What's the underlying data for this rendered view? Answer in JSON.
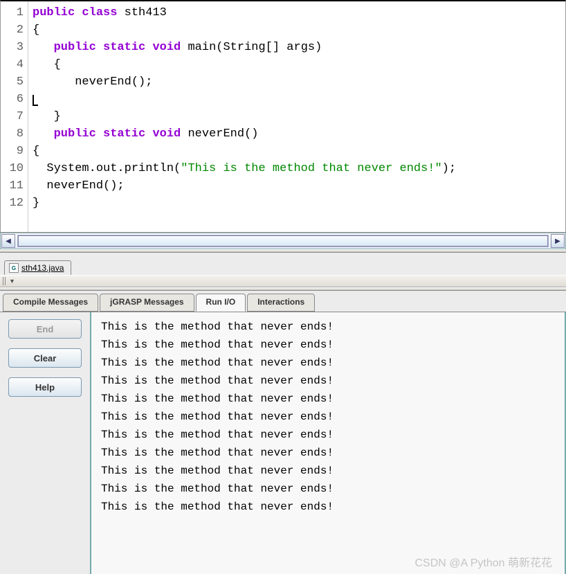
{
  "code": {
    "lines": [
      {
        "num": "1",
        "segments": [
          {
            "t": "public",
            "c": "kw-public"
          },
          {
            "t": " "
          },
          {
            "t": "class",
            "c": "kw-class"
          },
          {
            "t": " sth413"
          }
        ]
      },
      {
        "num": "2",
        "segments": [
          {
            "t": "{"
          }
        ]
      },
      {
        "num": "3",
        "segments": [
          {
            "t": "   "
          },
          {
            "t": "public",
            "c": "kw-public"
          },
          {
            "t": " "
          },
          {
            "t": "static",
            "c": "kw-static"
          },
          {
            "t": " "
          },
          {
            "t": "void",
            "c": "kw-void"
          },
          {
            "t": " main(String[] args)"
          }
        ]
      },
      {
        "num": "4",
        "segments": [
          {
            "t": "   {"
          }
        ]
      },
      {
        "num": "5",
        "segments": [
          {
            "t": "      neverEnd();"
          }
        ]
      },
      {
        "num": "6",
        "segments": [
          {
            "t": "",
            "cursor": true
          }
        ]
      },
      {
        "num": "7",
        "segments": [
          {
            "t": "   }"
          }
        ]
      },
      {
        "num": "8",
        "segments": [
          {
            "t": "   "
          },
          {
            "t": "public",
            "c": "kw-public"
          },
          {
            "t": " "
          },
          {
            "t": "static",
            "c": "kw-static"
          },
          {
            "t": " "
          },
          {
            "t": "void",
            "c": "kw-void"
          },
          {
            "t": " neverEnd()"
          }
        ]
      },
      {
        "num": "9",
        "segments": [
          {
            "t": "{"
          }
        ]
      },
      {
        "num": "10",
        "segments": [
          {
            "t": "  System.out.println("
          },
          {
            "t": "\"This is the method that never ends!\"",
            "c": "str"
          },
          {
            "t": ");"
          }
        ]
      },
      {
        "num": "11",
        "segments": [
          {
            "t": "  neverEnd();"
          }
        ]
      },
      {
        "num": "12",
        "segments": [
          {
            "t": "}"
          }
        ]
      }
    ]
  },
  "file_tab": {
    "icon_text": "G",
    "label": "sth413.java"
  },
  "bottom_tabs": [
    {
      "label": "Compile Messages",
      "active": false
    },
    {
      "label": "jGRASP Messages",
      "active": false
    },
    {
      "label": "Run I/O",
      "active": true
    },
    {
      "label": "Interactions",
      "active": false
    }
  ],
  "console_buttons": {
    "end": "End",
    "clear": "Clear",
    "help": "Help"
  },
  "console_output": [
    "This is the method that never ends!",
    "This is the method that never ends!",
    "This is the method that never ends!",
    "This is the method that never ends!",
    "This is the method that never ends!",
    "This is the method that never ends!",
    "This is the method that never ends!",
    "This is the method that never ends!",
    "This is the method that never ends!",
    "This is the method that never ends!",
    "This is the method that never ends!"
  ],
  "watermark": "CSDN @A Python 萌新花花"
}
